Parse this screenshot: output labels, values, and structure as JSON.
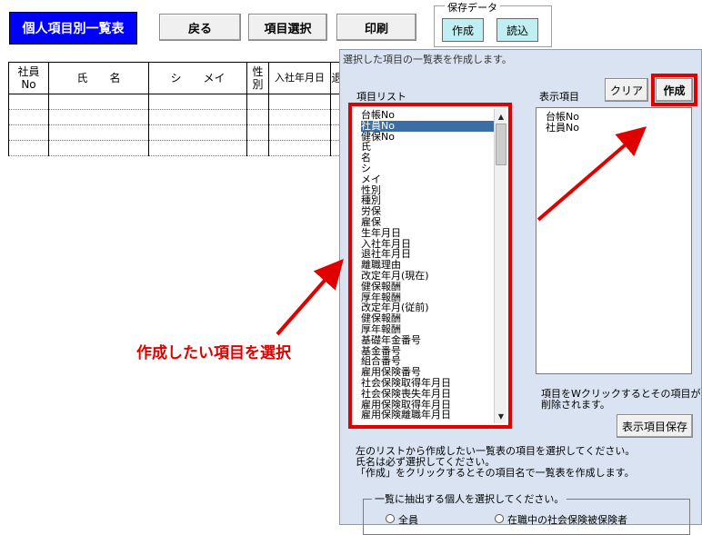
{
  "toolbar": {
    "title_button": "個人項目別一覧表",
    "back_button": "戻る",
    "select_button": "項目選択",
    "print_button": "印刷",
    "save_group_label": "保存データ",
    "save_create": "作成",
    "save_load": "読込"
  },
  "sheet": {
    "headers": [
      "社員\nNo",
      "氏　　名",
      "シ　　メイ",
      "性\n別",
      "入社年月日",
      "退"
    ]
  },
  "dialog": {
    "title": "選択した項目の一覧表を作成します。",
    "item_list_label": "項目リスト",
    "display_items_label": "表示項目",
    "clear_button": "クリア",
    "create_button": "作成",
    "item_list": [
      "台帳No",
      "社員No",
      "健保No",
      "氏",
      "名",
      "シ",
      "メイ",
      "性別",
      "種別",
      "労保",
      "雇保",
      "生年月日",
      "入社年月日",
      "退社年月日",
      "離職理由",
      "改定年月(現在)",
      "健保報酬",
      "厚年報酬",
      "改定年月(従前)",
      "健保報酬",
      "厚年報酬",
      "基礎年金番号",
      "基金番号",
      "組合番号",
      "雇用保険番号",
      "社会保険取得年月日",
      "社会保険喪失年月日",
      "雇用保険取得年月日",
      "雇用保険離職年月日"
    ],
    "selected_index": 1,
    "display_items": [
      "台帳No",
      "社員No"
    ],
    "remove_note_1": "項目をWクリックするとその項目が",
    "remove_note_2": "削除されます。",
    "save_display_button": "表示項目保存",
    "instr_1": "左のリストから作成したい一覧表の項目を選択してください。",
    "instr_2": "氏名は必ず選択してください。",
    "instr_3": "「作成」をクリックするとその項目名で一覧表を作成します。",
    "group_label": "一覧に抽出する個人を選択してください。",
    "radio_all": "全員",
    "radio_insured": "在職中の社会保険被保険者"
  },
  "annotation": {
    "text": "作成したい項目を選択",
    "color": "#e00000"
  }
}
